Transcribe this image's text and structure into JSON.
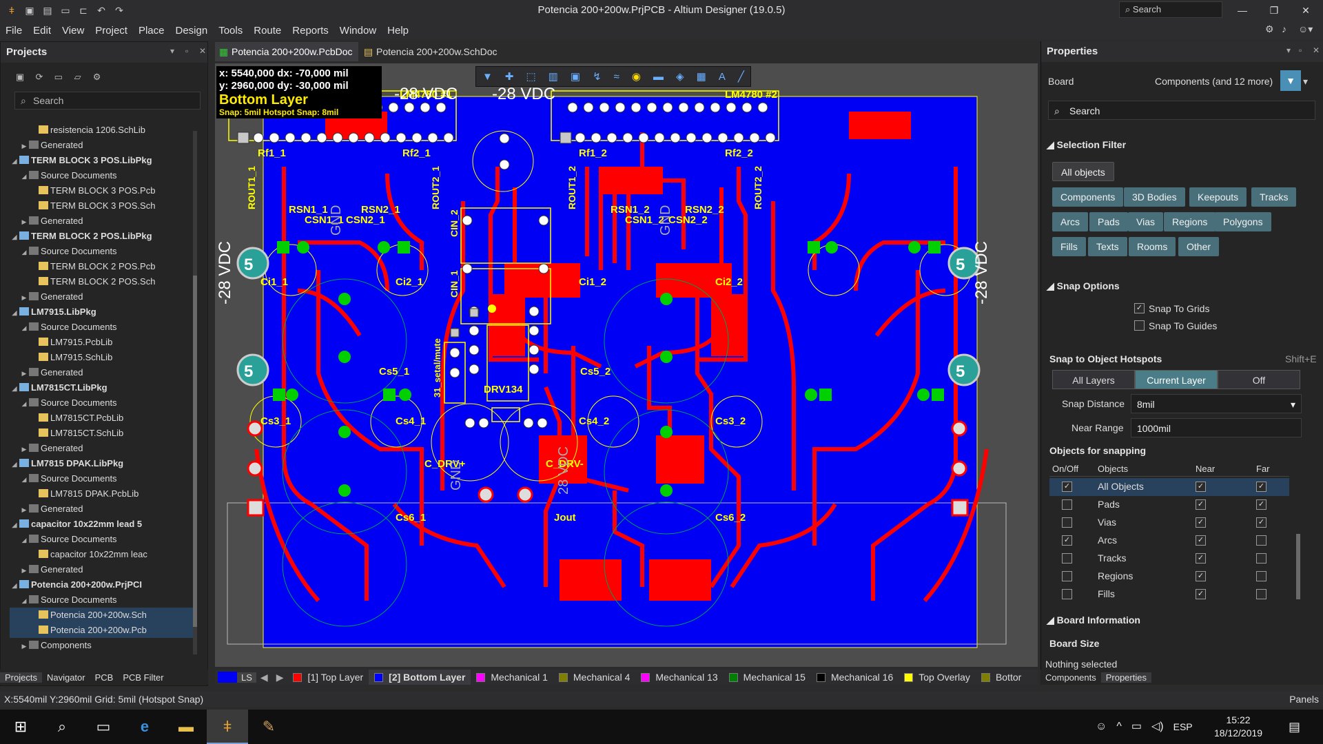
{
  "window": {
    "title": "Potencia 200+200w.PrjPCB - Altium Designer (19.0.5)",
    "search": "Search"
  },
  "menu": [
    "File",
    "Edit",
    "View",
    "Project",
    "Place",
    "Design",
    "Tools",
    "Route",
    "Reports",
    "Window",
    "Help"
  ],
  "projects": {
    "title": "Projects",
    "search_placeholder": "Search",
    "tree": [
      {
        "label": "resistencia 1206.SchLib",
        "indent": 3,
        "arrow": "",
        "bold": false,
        "sel": false
      },
      {
        "label": "Generated",
        "indent": 2,
        "arrow": "▶",
        "bold": false,
        "sel": false
      },
      {
        "label": "TERM BLOCK 3 POS.LibPkg",
        "indent": 1,
        "arrow": "◢",
        "bold": true,
        "sel": false
      },
      {
        "label": "Source Documents",
        "indent": 2,
        "arrow": "◢",
        "bold": false,
        "sel": false
      },
      {
        "label": "TERM BLOCK 3 POS.Pcb",
        "indent": 3,
        "arrow": "",
        "bold": false,
        "sel": false
      },
      {
        "label": "TERM BLOCK 3 POS.Sch",
        "indent": 3,
        "arrow": "",
        "bold": false,
        "sel": false
      },
      {
        "label": "Generated",
        "indent": 2,
        "arrow": "▶",
        "bold": false,
        "sel": false
      },
      {
        "label": "TERM BLOCK 2 POS.LibPkg",
        "indent": 1,
        "arrow": "◢",
        "bold": true,
        "sel": false
      },
      {
        "label": "Source Documents",
        "indent": 2,
        "arrow": "◢",
        "bold": false,
        "sel": false
      },
      {
        "label": "TERM BLOCK 2 POS.Pcb",
        "indent": 3,
        "arrow": "",
        "bold": false,
        "sel": false
      },
      {
        "label": "TERM BLOCK 2 POS.Sch",
        "indent": 3,
        "arrow": "",
        "bold": false,
        "sel": false
      },
      {
        "label": "Generated",
        "indent": 2,
        "arrow": "▶",
        "bold": false,
        "sel": false
      },
      {
        "label": "LM7915.LibPkg",
        "indent": 1,
        "arrow": "◢",
        "bold": true,
        "sel": false
      },
      {
        "label": "Source Documents",
        "indent": 2,
        "arrow": "◢",
        "bold": false,
        "sel": false
      },
      {
        "label": "LM7915.PcbLib",
        "indent": 3,
        "arrow": "",
        "bold": false,
        "sel": false
      },
      {
        "label": "LM7915.SchLib",
        "indent": 3,
        "arrow": "",
        "bold": false,
        "sel": false
      },
      {
        "label": "Generated",
        "indent": 2,
        "arrow": "▶",
        "bold": false,
        "sel": false
      },
      {
        "label": "LM7815CT.LibPkg",
        "indent": 1,
        "arrow": "◢",
        "bold": true,
        "sel": false
      },
      {
        "label": "Source Documents",
        "indent": 2,
        "arrow": "◢",
        "bold": false,
        "sel": false
      },
      {
        "label": "LM7815CT.PcbLib",
        "indent": 3,
        "arrow": "",
        "bold": false,
        "sel": false
      },
      {
        "label": "LM7815CT.SchLib",
        "indent": 3,
        "arrow": "",
        "bold": false,
        "sel": false
      },
      {
        "label": "Generated",
        "indent": 2,
        "arrow": "▶",
        "bold": false,
        "sel": false
      },
      {
        "label": "LM7815 DPAK.LibPkg",
        "indent": 1,
        "arrow": "◢",
        "bold": true,
        "sel": false
      },
      {
        "label": "Source Documents",
        "indent": 2,
        "arrow": "◢",
        "bold": false,
        "sel": false
      },
      {
        "label": "LM7815 DPAK.PcbLib",
        "indent": 3,
        "arrow": "",
        "bold": false,
        "sel": false
      },
      {
        "label": "Generated",
        "indent": 2,
        "arrow": "▶",
        "bold": false,
        "sel": false
      },
      {
        "label": "capacitor 10x22mm lead 5",
        "indent": 1,
        "arrow": "◢",
        "bold": true,
        "sel": false
      },
      {
        "label": "Source Documents",
        "indent": 2,
        "arrow": "◢",
        "bold": false,
        "sel": false
      },
      {
        "label": "capacitor 10x22mm leac",
        "indent": 3,
        "arrow": "",
        "bold": false,
        "sel": false
      },
      {
        "label": "Generated",
        "indent": 2,
        "arrow": "▶",
        "bold": false,
        "sel": false
      },
      {
        "label": "Potencia 200+200w.PrjPCI",
        "indent": 1,
        "arrow": "◢",
        "bold": true,
        "sel": false
      },
      {
        "label": "Source Documents",
        "indent": 2,
        "arrow": "◢",
        "bold": false,
        "sel": false
      },
      {
        "label": "Potencia 200+200w.Sch",
        "indent": 3,
        "arrow": "",
        "bold": false,
        "sel": true
      },
      {
        "label": "Potencia 200+200w.Pcb",
        "indent": 3,
        "arrow": "",
        "bold": false,
        "sel": true
      },
      {
        "label": "Components",
        "indent": 2,
        "arrow": "▶",
        "bold": false,
        "sel": false
      }
    ],
    "bottom_tabs": [
      "Projects",
      "Navigator",
      "PCB",
      "PCB Filter"
    ]
  },
  "doc_tabs": {
    "pcb": "Potencia 200+200w.PcbDoc *",
    "sch": "Potencia 200+200w.SchDoc"
  },
  "hud": {
    "x_line": "x: 5540,000   dx:  -70,000 mil",
    "y_line": "y: 2960,000   dy:  -30,000 mil",
    "layer": "Bottom Layer",
    "snap": "Snap: 5mil Hotspot Snap: 8mil"
  },
  "pcb_labels": {
    "lm1": "LM4780 #1",
    "lm2": "LM4780 #2",
    "vdc_top1": "-28 VDC",
    "vdc_top2": "-28 VDC",
    "vdc_left": "-28 VDC",
    "vdc_right": "-28 VDC",
    "rf11": "Rf1_1",
    "rf21": "Rf2_1",
    "rf12": "Rf1_2",
    "rf22": "Rf2_2",
    "rout11": "ROUT1_1",
    "rout21": "ROUT2_1",
    "rout12": "ROUT1_2",
    "rout22": "ROUT2_2",
    "rsn11": "RSN1_1",
    "rsn21": "RSN2_1",
    "rsn12": "RSN1_2",
    "rsn22": "RSN2_2",
    "csn11": "CSN1_1",
    "csn21": "CSN2_1",
    "csn12": "CSN1_2",
    "csn22": "CSN2_2",
    "ci11": "Ci1_1",
    "ci21": "Ci2_1",
    "ci12": "Ci1_2",
    "ci22": "Ci2_2",
    "cs31": "Cs3_1",
    "cs41": "Cs4_1",
    "cs51": "Cs5_1",
    "cs61": "Cs6_1",
    "cs32": "Cs3_2",
    "cs42": "Cs4_2",
    "cs52": "Cs5_2",
    "cs62": "Cs6_2",
    "cin1": "CIN_1",
    "cin2": "CIN_2",
    "gnd1": "GND",
    "gnd2": "GND",
    "gnd3": "GND",
    "drv": "DRV134",
    "mute": "31_setal/mute",
    "cdrvp": "C_DRV+",
    "cdrvn": "C_DRV-",
    "jout": "Jout",
    "vdc_bot": "28 VDC",
    "five": "5"
  },
  "properties": {
    "title": "Properties",
    "board": "Board",
    "components_filter": "Components (and 12 more)",
    "search_placeholder": "Search",
    "selection_filter": "Selection Filter",
    "all_objects": "All objects",
    "filters": [
      "Components",
      "3D Bodies",
      "Keepouts",
      "Tracks",
      "Arcs",
      "Pads",
      "Vias",
      "Regions",
      "Polygons",
      "Fills",
      "Texts",
      "Rooms",
      "Other"
    ],
    "snap_options": "Snap Options",
    "snap_to_grids": "Snap To Grids",
    "snap_to_guides": "Snap To Guides",
    "snap_hotspots": "Snap to Object Hotspots",
    "shortcut": "Shift+E",
    "seg_all": "All Layers",
    "seg_current": "Current Layer",
    "seg_off": "Off",
    "snap_distance_label": "Snap Distance",
    "snap_distance": "8mil",
    "near_range_label": "Near Range",
    "near_range": "1000mil",
    "objects_for_snapping": "Objects for snapping",
    "col_onoff": "On/Off",
    "col_objects": "Objects",
    "col_near": "Near",
    "col_far": "Far",
    "rows": [
      {
        "name": "All Objects",
        "on": true,
        "near": true,
        "far": true
      },
      {
        "name": "Pads",
        "on": false,
        "near": true,
        "far": true
      },
      {
        "name": "Vias",
        "on": false,
        "near": true,
        "far": true
      },
      {
        "name": "Arcs",
        "on": true,
        "near": true,
        "far": false
      },
      {
        "name": "Tracks",
        "on": false,
        "near": true,
        "far": false
      },
      {
        "name": "Regions",
        "on": false,
        "near": true,
        "far": false
      },
      {
        "name": "Fills",
        "on": false,
        "near": true,
        "far": false
      }
    ],
    "board_information": "Board Information",
    "board_size": "Board Size",
    "nothing_selected": "Nothing selected",
    "bottom_tabs": [
      "Components",
      "Properties"
    ]
  },
  "layers": {
    "ls": "LS",
    "tabs": [
      {
        "label": "[1] Top Layer",
        "color": "#ff0000",
        "active": false
      },
      {
        "label": "[2] Bottom Layer",
        "color": "#0000ff",
        "active": true
      },
      {
        "label": "Mechanical 1",
        "color": "#ff00ff",
        "active": false
      },
      {
        "label": "Mechanical 4",
        "color": "#808000",
        "active": false
      },
      {
        "label": "Mechanical 13",
        "color": "#ff00ff",
        "active": false
      },
      {
        "label": "Mechanical 15",
        "color": "#008000",
        "active": false
      },
      {
        "label": "Mechanical 16",
        "color": "#000000",
        "active": false
      },
      {
        "label": "Top Overlay",
        "color": "#ffff00",
        "active": false
      },
      {
        "label": "Bottor",
        "color": "#808000",
        "active": false
      }
    ]
  },
  "status": {
    "left": "X:5540mil Y:2960mil   Grid: 5mil      (Hotspot Snap)",
    "panels": "Panels"
  },
  "taskbar": {
    "lang": "ESP",
    "time": "15:22",
    "date": "18/12/2019"
  }
}
